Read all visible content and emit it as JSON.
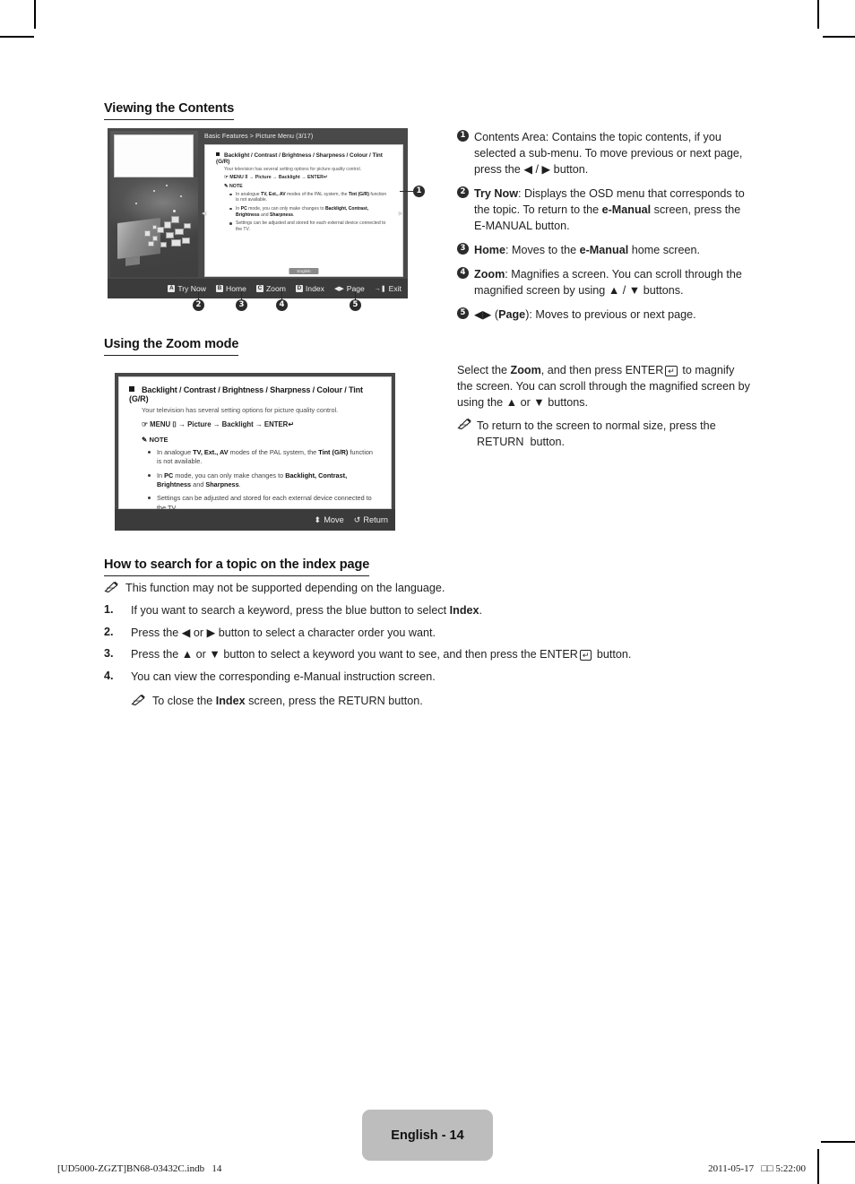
{
  "page": {
    "footer_badge": "English - 14",
    "footer_left": "[UD5000-ZGZT]BN68-03432C.indb   14",
    "footer_right": "2011-05-17   □□ 5:22:00"
  },
  "sections": {
    "viewing_contents": {
      "heading": "Viewing the Contents"
    },
    "zoom_mode": {
      "heading": "Using the Zoom mode"
    },
    "index_search": {
      "heading": "How to search for a topic on the index page"
    }
  },
  "tv_figure": {
    "breadcrumb": "Basic Features > Picture Menu (3/17)",
    "title": "Backlight / Contrast / Brightness / Sharpness / Colour / Tint (G/R)",
    "subtitle": "Your television has several setting options for picture quality control.",
    "path": "MENU ⌷ → Picture → Backlight → ENTER",
    "note_label": "NOTE",
    "notes": [
      "In analogue TV, Ext., AV modes of the PAL system, the Tint (G/R) function is not available.",
      "In PC mode, you can only make changes to Backlight, Contrast, Brightness and Sharpness.",
      "Settings can be adjusted and stored for each external device connected to the TV."
    ],
    "language_tab": "English",
    "toolbar": [
      {
        "key": "A",
        "label": "Try Now"
      },
      {
        "key": "B",
        "label": "Home"
      },
      {
        "key": "C",
        "label": "Zoom"
      },
      {
        "key": "D",
        "label": "Index"
      },
      {
        "key": "◀▶",
        "label": "Page"
      },
      {
        "key": "→❚",
        "label": "Exit"
      }
    ],
    "callouts": [
      "1",
      "2",
      "3",
      "4",
      "5"
    ]
  },
  "zoom_figure": {
    "title": "Backlight / Contrast / Brightness / Sharpness / Colour / Tint (G/R)",
    "subtitle": "Your television has several setting options for picture quality control.",
    "path": "MENU ⌷ → Picture → Backlight → ENTER",
    "note_label": "NOTE",
    "notes": [
      {
        "plain1": "In analogue ",
        "b1": "TV, Ext., AV",
        "plain2": " modes of the PAL system, the ",
        "b2": "Tint (G/R)",
        "plain3": " function is not available."
      },
      {
        "plain1": "In ",
        "b1": "PC",
        "plain2": " mode, you can only make changes to ",
        "b2": "Backlight, Contrast, Brightness",
        "plain3": " and ",
        "b3": "Sharpness",
        "plain4": "."
      },
      {
        "plain1": "Settings can be adjusted and stored for each external device connected to the TV.",
        "b1": "",
        "plain2": "",
        "b2": "",
        "plain3": ""
      }
    ],
    "footer_buttons": [
      {
        "icon": "⬍",
        "label": "Move"
      },
      {
        "icon": "↺",
        "label": "Return"
      }
    ]
  },
  "legend": [
    {
      "num": "1",
      "plain1": "Contents Area: Contains the topic contents, if you selected a sub-menu. To move previous or next page, press the ",
      "b1": "",
      "mid": "◀ / ▶",
      "plain2": " button."
    },
    {
      "num": "2",
      "b_lead": "Try Now",
      "plain1": ": Displays the OSD menu that corresponds to the topic. To return to the ",
      "b1": "e-Manual",
      "plain2": " screen, press the ",
      "b2_plain": "E-MANUAL",
      "plain3": " button."
    },
    {
      "num": "3",
      "b_lead": "Home",
      "plain1": ": Moves to the ",
      "b1": "e-Manual",
      "plain2": " home screen."
    },
    {
      "num": "4",
      "b_lead": "Zoom",
      "plain1": ": Magnifies a screen. You can scroll through the magnified screen by using ",
      "mid": "▲ / ▼",
      "plain2": " buttons."
    },
    {
      "num": "5",
      "icon": "◀▶",
      "b_lead": "(Page)",
      "plain1": ": Moves to previous or next page."
    }
  ],
  "zoom_text": {
    "paragraph_a": "Select the ",
    "paragraph_b": "Zoom",
    "paragraph_c": ", and then press ",
    "paragraph_d": "ENTER",
    "paragraph_e": " to magnify the screen. You can scroll through the magnified screen by using the ",
    "paragraph_f": "▲ or ▼",
    "paragraph_g": " buttons.",
    "note_a": "To return to the screen to normal size, press the ",
    "note_b": "RETURN",
    "note_c": " button."
  },
  "index_steps": {
    "intro_note": "This function may not be supported depending on the language.",
    "steps": [
      {
        "num": "1.",
        "a": "If you want to search a keyword, press the blue button to select ",
        "b": "Index",
        "c": "."
      },
      {
        "num": "2.",
        "a": "Press the ◀ or ▶ button to select a character order you want.",
        "b": "",
        "c": ""
      },
      {
        "num": "3.",
        "a": "Press the ▲ or ▼ button to select a keyword you want to see, and then press the ",
        "b": "ENTER",
        "c": " button."
      },
      {
        "num": "4.",
        "a": "You can view the corresponding e-Manual instruction screen.",
        "b": "",
        "c": ""
      }
    ],
    "closing_note_a": "To close the ",
    "closing_note_b": "Index",
    "closing_note_c": " screen, press the ",
    "closing_note_d": "RETURN",
    "closing_note_e": " button."
  }
}
